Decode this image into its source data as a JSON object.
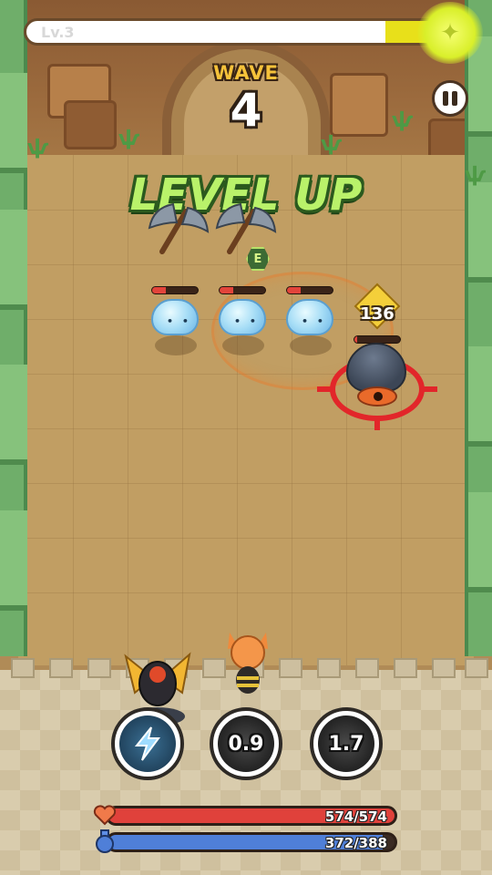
{
  "hud": {
    "level_label": "Lv.3",
    "xp_progress": 0.15,
    "wave_label": "WAVE",
    "wave_number": "4",
    "banner": "LEVEL UP"
  },
  "pickup": {
    "label": "E"
  },
  "enemies": {
    "slimes": [
      {
        "hp_fraction": 0.3
      },
      {
        "hp_fraction": 0.3
      },
      {
        "hp_fraction": 0.3
      }
    ],
    "boss": {
      "hp_fraction": 0.05,
      "damage_popup": "136"
    }
  },
  "skills": [
    {
      "icon": "lightning-icon",
      "state": "ready",
      "cooldown": ""
    },
    {
      "icon": "skill-icon",
      "state": "cooldown",
      "cooldown": "0.9"
    },
    {
      "icon": "skill-icon",
      "state": "cooldown",
      "cooldown": "1.7"
    }
  ],
  "stats": {
    "hp": {
      "icon": "heart-icon",
      "text": "574/574",
      "fraction": 1.0,
      "color": "#e0413b"
    },
    "mp": {
      "icon": "potion-icon",
      "text": "372/388",
      "fraction": 0.96,
      "color": "#4f7fd8"
    }
  },
  "colors": {
    "banner_green": "#b9f26a",
    "wave_gold": "#f6c23a",
    "target_red": "#e2262a",
    "xp_yellow": "#e8e01a"
  }
}
